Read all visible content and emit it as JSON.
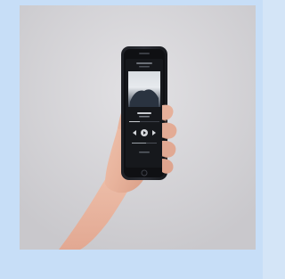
{
  "scene": {
    "subject": "hand-holding-smartphone",
    "background_color": "#d2d1d4",
    "frame_color": "#c7def7"
  },
  "phone": {
    "screen_text": []
  }
}
